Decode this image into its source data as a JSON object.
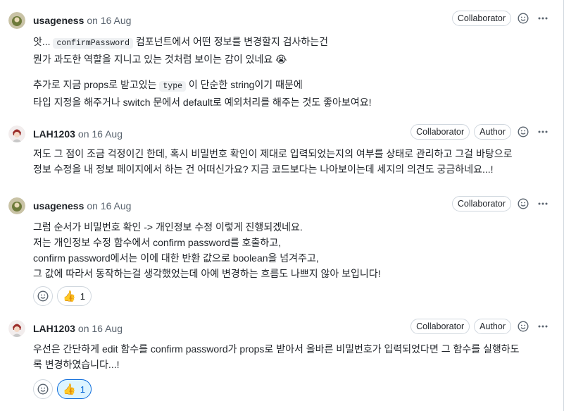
{
  "comments": [
    {
      "author": "usageness",
      "date": "on 16 Aug",
      "badges": [
        "Collaborator"
      ],
      "body": {
        "l1_pre": "앗... ",
        "l1_code": "confirmPassword",
        "l1_post": " 컴포넌트에서 어떤 정보를 변경할지 검사하는건",
        "l2": "뭔가 과도한 역할을 지니고 있는 것처럼 보이는 감이 있네요 😭",
        "l3_pre": "추가로 지금 props로 받고있는 ",
        "l3_code": "type",
        "l3_post": " 이 단순한 string이기 때문에",
        "l4": "타입 지정을 해주거나 switch 문에서 default로 예외처리를 해주는 것도 좋아보여요!"
      }
    },
    {
      "author": "LAH1203",
      "date": "on 16 Aug",
      "badges": [
        "Collaborator",
        "Author"
      ],
      "body": {
        "l1": "저도 그 점이 조금 걱정이긴 한데, 혹시 비밀번호 확인이 제대로 입력되었는지의 여부를 상태로 관리하고 그걸 바탕으로",
        "l2": "정보 수정을 내 정보 페이지에서 하는 건 어떠신가요? 지금 코드보다는 나아보이는데 세지의 의견도 궁금하네요...!"
      }
    },
    {
      "author": "usageness",
      "date": "on 16 Aug",
      "badges": [
        "Collaborator"
      ],
      "body": {
        "l1": "그럼 순서가 비밀번호 확인 -> 개인정보 수정 이렇게 진행되겠네요.",
        "l2": "저는 개인정보 수정 함수에서 confirm password를 호출하고,",
        "l3": "confirm password에서는 이에 대한 반환 값으로 boolean을 넘겨주고,",
        "l4": "그 값에 따라서 동작하는걸 생각했었는데 아예 변경하는 흐름도 나쁘지 않아 보입니다!"
      },
      "reaction": {
        "emoji": "👍",
        "count": "1"
      }
    },
    {
      "author": "LAH1203",
      "date": "on 16 Aug",
      "badges": [
        "Collaborator",
        "Author"
      ],
      "body": {
        "l1": "우선은 간단하게 edit 함수를 confirm password가 props로 받아서 올바른 비밀번호가 입력되었다면 그 함수를 실행하도",
        "l2": "록 변경하였습니다...!"
      },
      "reaction": {
        "emoji": "👍",
        "count": "1"
      }
    }
  ],
  "icons": [
    "smiley-icon",
    "kebab-icon",
    "thumbs-up-icon"
  ]
}
